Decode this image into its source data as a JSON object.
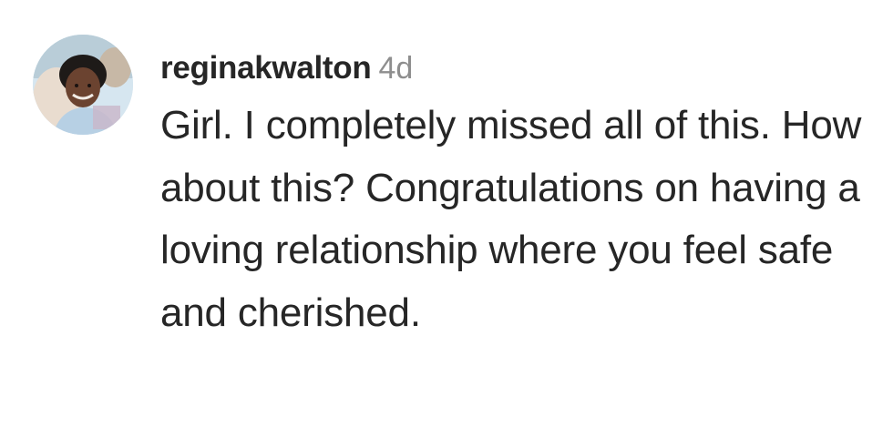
{
  "comment": {
    "username": "reginakwalton",
    "time": "4d",
    "text": "Girl. I completely missed all of this. How about this? Congratulations on having a loving relationship where you feel safe and cherished."
  }
}
